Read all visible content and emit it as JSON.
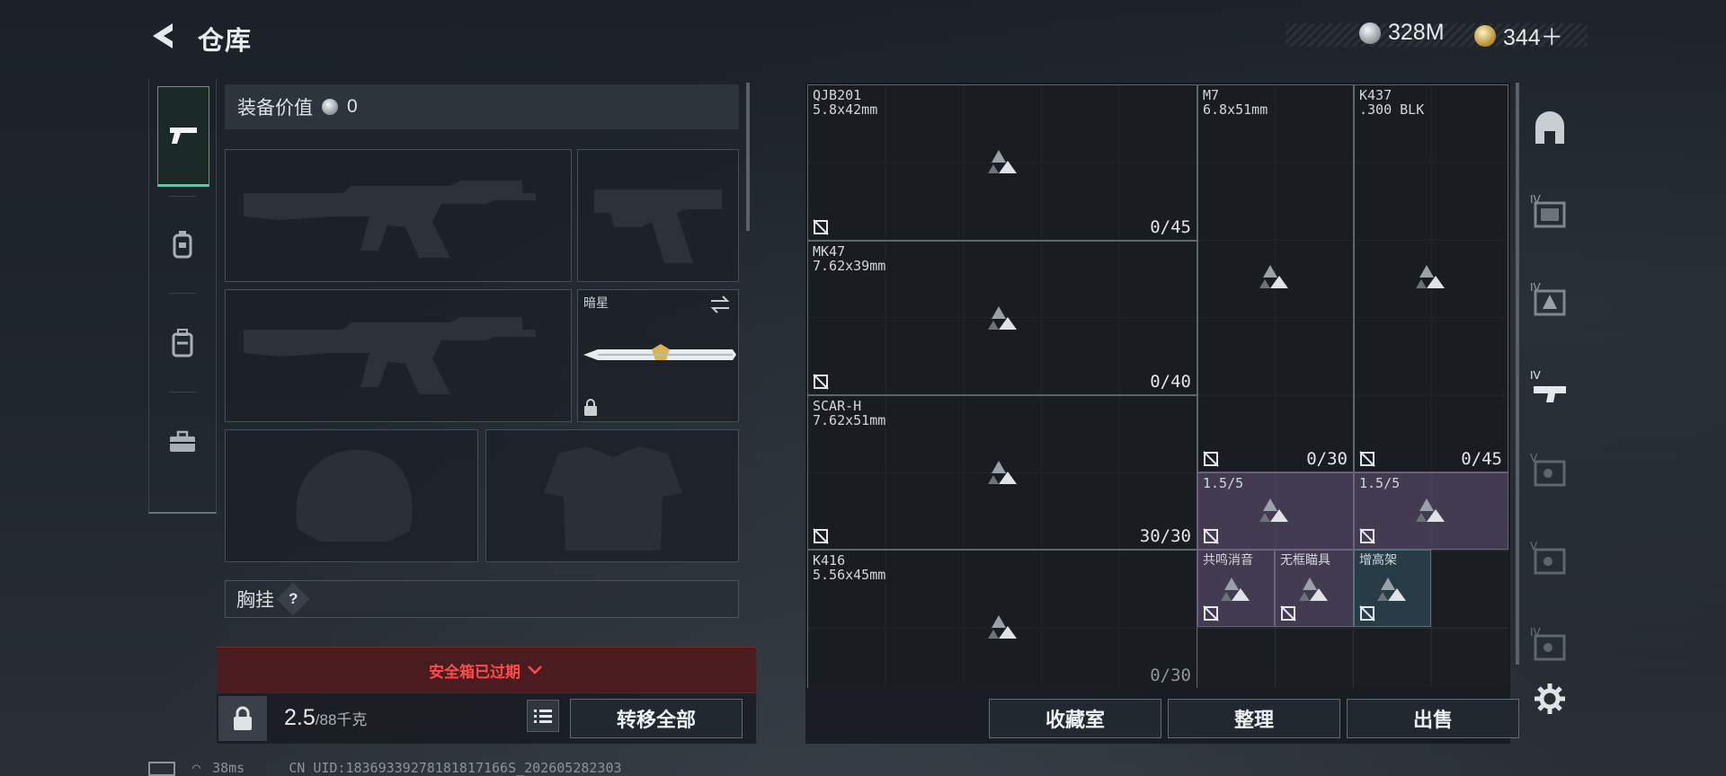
{
  "header": {
    "title": "仓库",
    "currency_1": "328M",
    "currency_2": "344＋"
  },
  "left_tabs": [
    {
      "icon": "pistol-icon",
      "active": true
    },
    {
      "icon": "grenade-icon",
      "active": false
    },
    {
      "icon": "backpack-icon",
      "active": false
    },
    {
      "icon": "toolbox-icon",
      "active": false
    }
  ],
  "equipment": {
    "value_label": "装备价值",
    "value": "0",
    "knife_name": "暗星",
    "chest_rig_label": "胸挂",
    "help_mark": "?"
  },
  "safe_box": {
    "alert": "安全箱已过期"
  },
  "footer": {
    "weight": "2.5",
    "weight_max": "/88千克",
    "transfer_all": "转移全部",
    "collection": "收藏室",
    "sort": "整理",
    "sell": "出售"
  },
  "storage_items": [
    {
      "name": "QJB201",
      "ammo": "5.8x42mm",
      "count": "0/45"
    },
    {
      "name": "M7",
      "ammo": "6.8x51mm",
      "count": "0/30"
    },
    {
      "name": "K437",
      "ammo": ".300 BLK",
      "count": "0/45"
    },
    {
      "name": "MK47",
      "ammo": "7.62x39mm",
      "count": "0/40"
    },
    {
      "name": "SCAR-H",
      "ammo": "7.62x51mm",
      "count": "30/30"
    },
    {
      "name": "K416",
      "ammo": "5.56x45mm",
      "count": "0/30"
    },
    {
      "name": "1.5/5"
    },
    {
      "name": "1.5/5"
    },
    {
      "name": "共鸣消音"
    },
    {
      "name": "无框瞄具"
    },
    {
      "name": "增高架"
    }
  ],
  "status": {
    "ping": "38ms",
    "uid": "CN UID:18369339278181817166S_202605282303"
  },
  "colors": {
    "accent_green": "#3fd9a0",
    "alert_red": "#ff4b4b",
    "purple_item": "#524662",
    "teal_item": "#2c424e"
  }
}
